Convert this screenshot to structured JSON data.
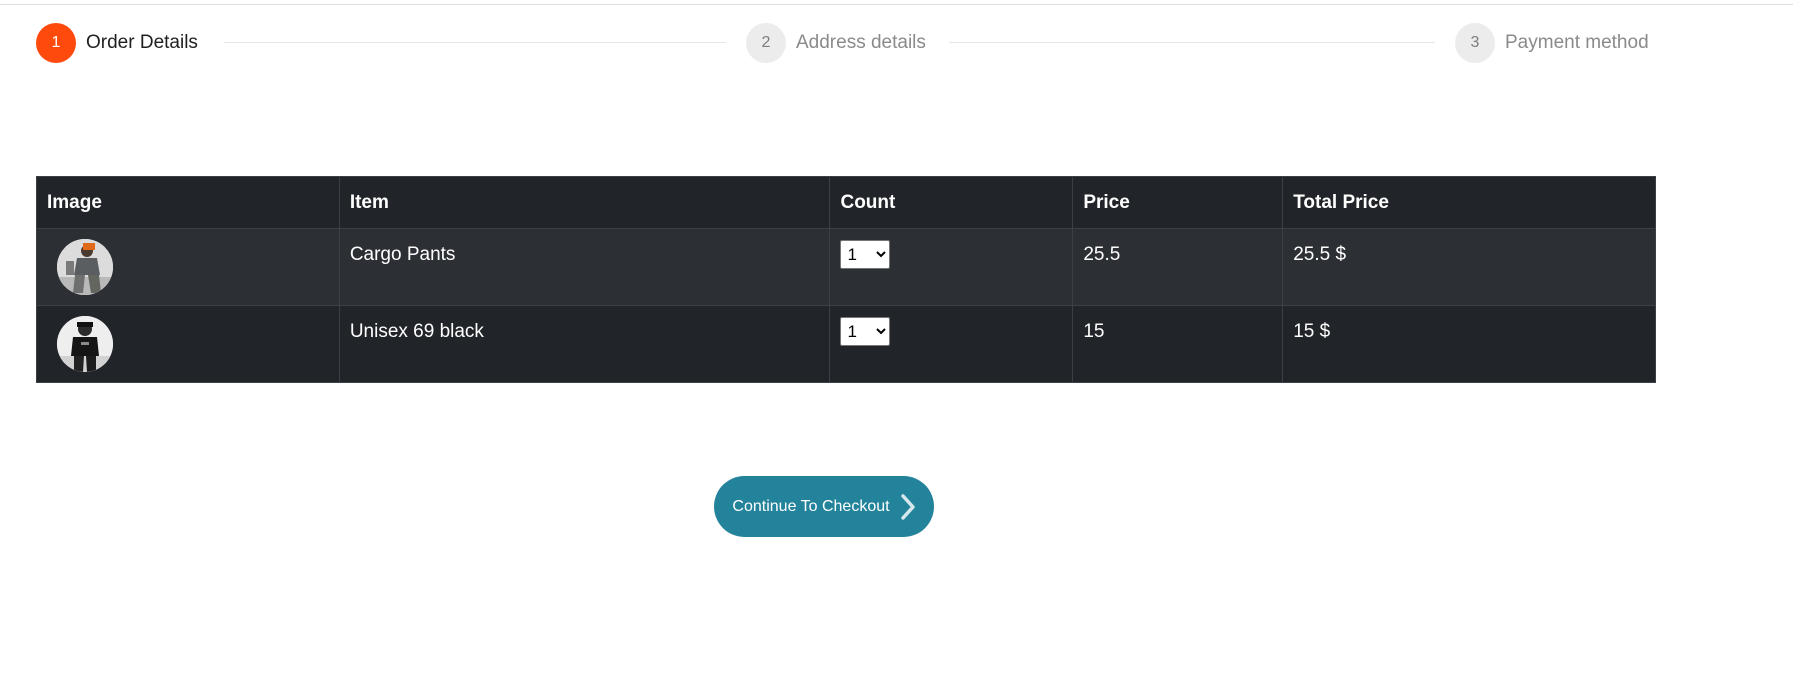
{
  "stepper": {
    "steps": [
      {
        "number": "1",
        "label": "Order Details",
        "state": "active"
      },
      {
        "number": "2",
        "label": "Address details",
        "state": "inactive"
      },
      {
        "number": "3",
        "label": "Payment method",
        "state": "inactive"
      }
    ]
  },
  "table": {
    "headers": [
      "Image",
      "Item",
      "Count",
      "Price",
      "Total Price"
    ],
    "rows": [
      {
        "item": "Cargo Pants",
        "count": "1",
        "price": "25.5",
        "total": "25.5 $",
        "image_icon": "product-photo-icon"
      },
      {
        "item": "Unisex 69 black",
        "count": "1",
        "price": "15",
        "total": "15 $",
        "image_icon": "product-photo-icon"
      }
    ]
  },
  "checkout": {
    "label": "Continue To Checkout",
    "icon": "chevron-right-icon"
  },
  "colors": {
    "active_step": "#ff4a0d",
    "table_bg": "#212529",
    "button_bg": "#23839b"
  }
}
